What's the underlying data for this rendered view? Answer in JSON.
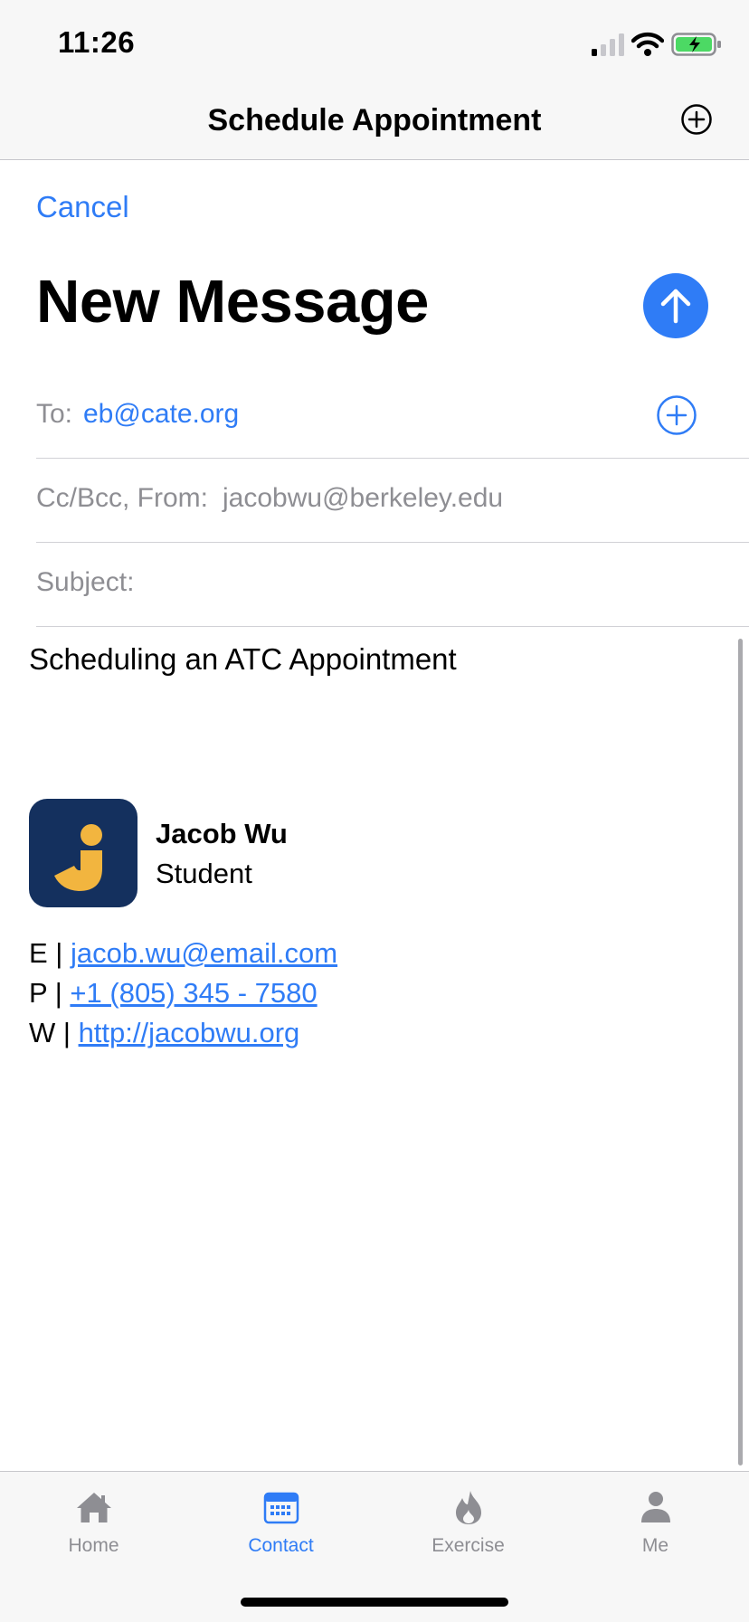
{
  "status_bar": {
    "time": "11:26"
  },
  "navbar": {
    "title": "Schedule Appointment"
  },
  "compose": {
    "cancel_label": "Cancel",
    "heading": "New Message",
    "to_label": "To:",
    "to_value": "eb@cate.org",
    "cc_label": "Cc/Bcc, From:",
    "cc_value": "jacobwu@berkeley.edu",
    "subject_label": "Subject:",
    "body": "Scheduling an ATC Appointment"
  },
  "signature": {
    "name": "Jacob Wu",
    "role": "Student",
    "email_prefix": "E |",
    "email": "jacob.wu@email.com",
    "phone_prefix": "P |",
    "phone": "+1 (805) 345 - 7580",
    "web_prefix": "W |",
    "web": "http://jacobwu.org"
  },
  "tabs": [
    {
      "label": "Home",
      "icon": "house-icon",
      "active": false
    },
    {
      "label": "Contact",
      "icon": "calendar-icon",
      "active": true
    },
    {
      "label": "Exercise",
      "icon": "flame-icon",
      "active": false
    },
    {
      "label": "Me",
      "icon": "person-icon",
      "active": false
    }
  ],
  "colors": {
    "accent": "#2f7cf6",
    "secondary_text": "#8e8e93",
    "logo_background": "#14305e",
    "logo_mark": "#f2b53f",
    "battery_fill": "#4cd964"
  }
}
